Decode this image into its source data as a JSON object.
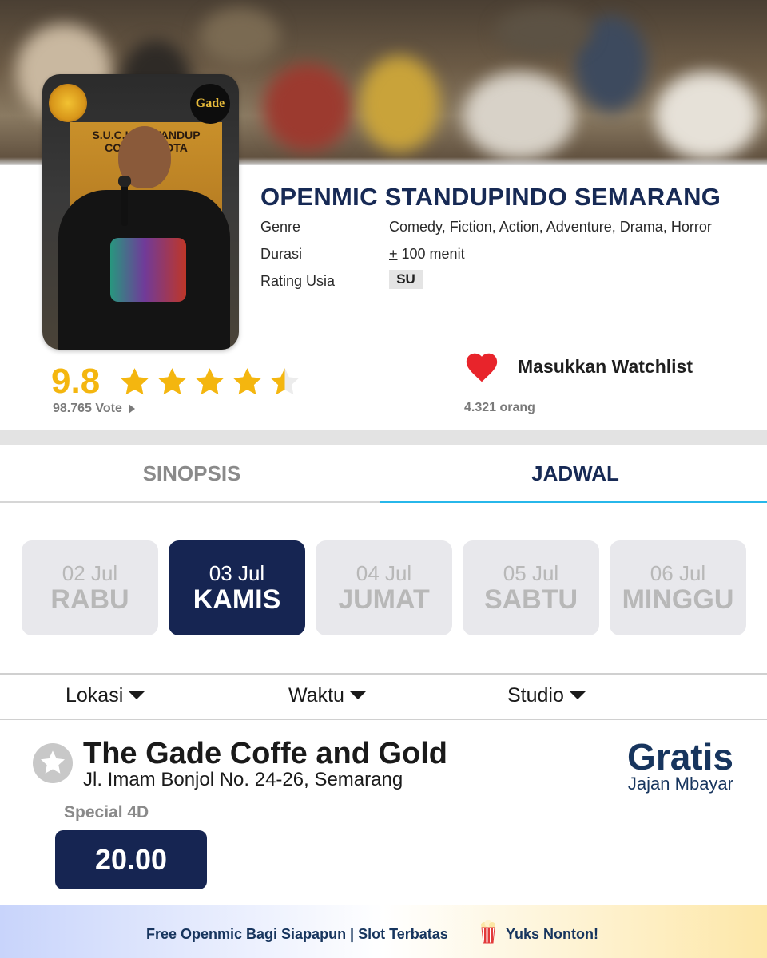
{
  "event": {
    "title": "OPENMIC STANDUPINDO SEMARANG",
    "genre_label": "Genre",
    "genre_value": "Comedy, Fiction, Action, Adventure, Drama, Horror",
    "duration_label": "Durasi",
    "duration_plus": "+",
    "duration_value": " 100 menit",
    "rating_label": "Rating Usia",
    "rating_value": "SU",
    "poster_logo_text": "Gade",
    "poster_sign_text": "S.U.C.K.S STANDUP COMEDY KOTA"
  },
  "score": {
    "value": "9.8",
    "votes": "98.765 Vote",
    "stars_filled": 4.5,
    "stars_total": 5
  },
  "watchlist": {
    "label": "Masukkan Watchlist",
    "count": "4.321 orang"
  },
  "tabs": [
    {
      "label": "SINOPSIS",
      "active": false
    },
    {
      "label": "JADWAL",
      "active": true
    }
  ],
  "dates": [
    {
      "date": "02 Jul",
      "day": "RABU",
      "active": false
    },
    {
      "date": "03 Jul",
      "day": "KAMIS",
      "active": true
    },
    {
      "date": "04 Jul",
      "day": "JUMAT",
      "active": false
    },
    {
      "date": "05 Jul",
      "day": "SABTU",
      "active": false
    },
    {
      "date": "06 Jul",
      "day": "MINGGU",
      "active": false
    }
  ],
  "filters": {
    "location": "Lokasi",
    "time": "Waktu",
    "studio": "Studio"
  },
  "venue": {
    "name": "The Gade Coffe and Gold",
    "address": "Jl. Imam Bonjol No. 24-26, Semarang",
    "price": "Gratis",
    "price_note": "Jajan Mbayar",
    "studio_type": "Special 4D",
    "showtime": "20.00"
  },
  "footer": {
    "text": "Free Openmic Bagi Siapapun | Slot Terbatas",
    "cta": "Yuks Nonton!"
  },
  "colors": {
    "navy": "#162552",
    "title_blue": "#172a55",
    "star_gold": "#f4b60f",
    "heart_red": "#e8242b",
    "tab_accent": "#27b7ea"
  }
}
